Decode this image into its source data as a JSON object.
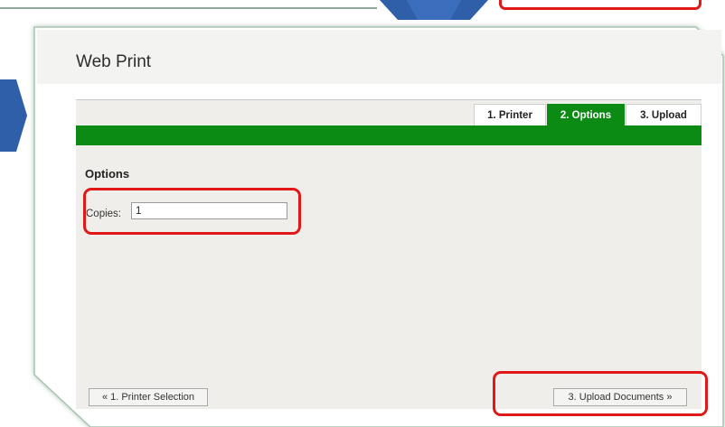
{
  "app": {
    "title": "Web Print"
  },
  "tabs": [
    {
      "label": "1. Printer",
      "active": false
    },
    {
      "label": "2. Options",
      "active": true
    },
    {
      "label": "3. Upload",
      "active": false
    }
  ],
  "options": {
    "heading": "Options",
    "copies_label": "Copies:",
    "copies_value": "1"
  },
  "buttons": {
    "prev_label": "« 1. Printer Selection",
    "next_label": "3. Upload Documents »"
  },
  "colors": {
    "accent_green": "#0b8a14",
    "highlight_red": "#e01818",
    "arrow_blue": "#2f5fa8"
  }
}
